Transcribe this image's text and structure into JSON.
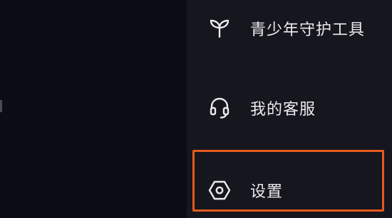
{
  "menu": {
    "items": [
      {
        "label": "青少年守护工具",
        "icon": "sprout-icon"
      },
      {
        "label": "我的客服",
        "icon": "headset-icon"
      },
      {
        "label": "设置",
        "icon": "hexagon-settings-icon"
      }
    ],
    "highlighted_item": "设置"
  },
  "colors": {
    "background": "#0e0e16",
    "drawer": "#16161f",
    "text": "#ebebee",
    "highlight": "#e45a1c"
  }
}
